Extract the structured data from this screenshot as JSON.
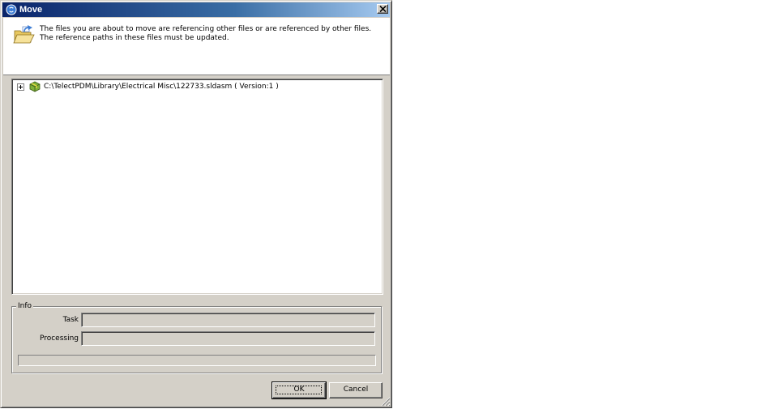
{
  "window": {
    "title": "Move",
    "close_glyph": "×"
  },
  "header": {
    "line1": "The files you are about to move are referencing other files or are referenced by other files.",
    "line2": "The reference paths in these files must be updated.",
    "icon": "folder-open-icon"
  },
  "tree": {
    "items": [
      {
        "label": "C:\\TelectPDM\\Library\\Electrical Misc\\122733.sldasm  ( Version:1 )",
        "expanded": false,
        "icon": "assembly-icon"
      }
    ]
  },
  "info": {
    "legend": "Info",
    "task_label": "Task",
    "task_value": "",
    "processing_label": "Processing",
    "processing_value": "",
    "progress": 0
  },
  "buttons": {
    "ok": "OK",
    "cancel": "Cancel"
  },
  "colors": {
    "dialog_bg": "#d4d0c8",
    "titlebar_start": "#0a246a",
    "titlebar_end": "#a6caf0"
  }
}
